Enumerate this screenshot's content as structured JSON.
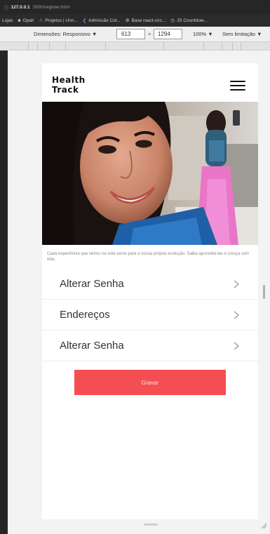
{
  "browser": {
    "url_host": "127.0.0.1",
    "url_path": ":5500/register.html",
    "bookmarks": [
      {
        "label": "Lojas",
        "icon": ""
      },
      {
        "label": "Opah",
        "icon": "folder-icon"
      },
      {
        "label": "Projetos | Unn...",
        "icon": "person-icon"
      },
      {
        "label": "Admissão Col...",
        "icon": "arrow-icon"
      },
      {
        "label": "Base react-circ...",
        "icon": "gear-icon"
      },
      {
        "label": "JS Countdow...",
        "icon": "clock-icon"
      }
    ]
  },
  "device_toolbar": {
    "dimensions_label": "Dimensões: Responsivo ▼",
    "width": "613",
    "height": "1294",
    "times": "×",
    "zoom": "100% ▼",
    "throttle": "Sem limitação ▼"
  },
  "app": {
    "logo_line1": "Health",
    "logo_line2": "Track",
    "caption": "Cada experiência que temos na vida serve para a nossa própria evolução. Saiba aproveitá-las e cresça com elas.",
    "menu_items": [
      {
        "label": "Alterar Senha"
      },
      {
        "label": "Endereços"
      },
      {
        "label": "Alterar Senha"
      }
    ],
    "submit_label": "Gravar"
  },
  "colors": {
    "accent": "#f44e52",
    "page_bg": "#ffffff",
    "viewport_bg": "#f3f3f3"
  }
}
